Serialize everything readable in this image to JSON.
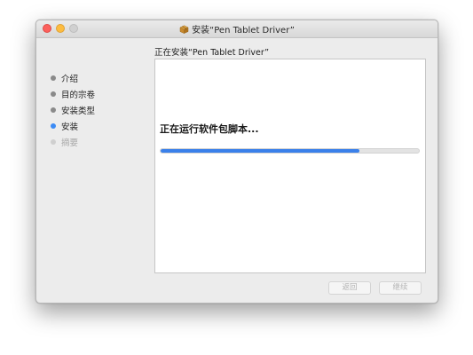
{
  "window": {
    "title": "安装“Pen Tablet Driver”",
    "icon": "package-icon"
  },
  "heading": "正在安装“Pen Tablet Driver”",
  "sidebar": {
    "steps": [
      {
        "label": "介绍",
        "state": "done"
      },
      {
        "label": "目的宗卷",
        "state": "done"
      },
      {
        "label": "安装类型",
        "state": "done"
      },
      {
        "label": "安装",
        "state": "current"
      },
      {
        "label": "摘要",
        "state": "disabled"
      }
    ]
  },
  "content": {
    "status": "正在运行软件包脚本...",
    "progress": 0.77
  },
  "buttons": {
    "back": "返回",
    "continue": "继续"
  },
  "colors": {
    "accent": "#3c8bf5",
    "progress_fill": "#3a80ea",
    "close": "#fc605c",
    "minimize": "#fdbc40",
    "zoom": "#d0d0d0"
  }
}
